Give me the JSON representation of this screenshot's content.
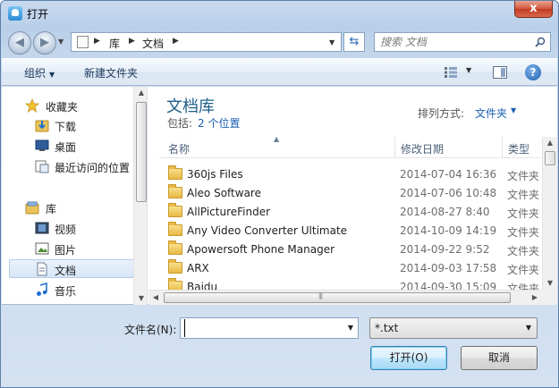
{
  "window": {
    "title": "打开",
    "close": "x"
  },
  "address": {
    "breadcrumb": [
      "库",
      "文档"
    ],
    "search_placeholder": "搜索 文档"
  },
  "toolbar": {
    "organize": "组织",
    "new_folder": "新建文件夹"
  },
  "nav": {
    "favorites_header": "收藏夹",
    "favorites": [
      "下载",
      "桌面",
      "最近访问的位置"
    ],
    "libraries_header": "库",
    "libraries": [
      "视频",
      "图片",
      "文档",
      "音乐"
    ],
    "selected": "文档"
  },
  "library": {
    "title": "文档库",
    "includes_label": "包括:",
    "includes_link": "2 个位置",
    "arrange_label": "排列方式:",
    "arrange_value": "文件夹"
  },
  "columns": {
    "name": "名称",
    "date": "修改日期",
    "type": "类型"
  },
  "files": [
    {
      "name": "360js Files",
      "date": "2014-07-04 16:36",
      "type": "文件夹"
    },
    {
      "name": "Aleo Software",
      "date": "2014-07-06 10:48",
      "type": "文件夹"
    },
    {
      "name": "AllPictureFinder",
      "date": "2014-08-27 8:40",
      "type": "文件夹"
    },
    {
      "name": "Any Video Converter Ultimate",
      "date": "2014-10-09 14:19",
      "type": "文件夹"
    },
    {
      "name": "Apowersoft Phone Manager",
      "date": "2014-09-22 9:52",
      "type": "文件夹"
    },
    {
      "name": "ARX",
      "date": "2014-09-03 17:58",
      "type": "文件夹"
    },
    {
      "name": "Baidu",
      "date": "2014-09-30 15:09",
      "type": "文件夹"
    }
  ],
  "bottom": {
    "filename_label": "文件名(N):",
    "filename_value": "",
    "filetype_value": "*.txt",
    "open_button": "打开(O)",
    "cancel_button": "取消"
  }
}
